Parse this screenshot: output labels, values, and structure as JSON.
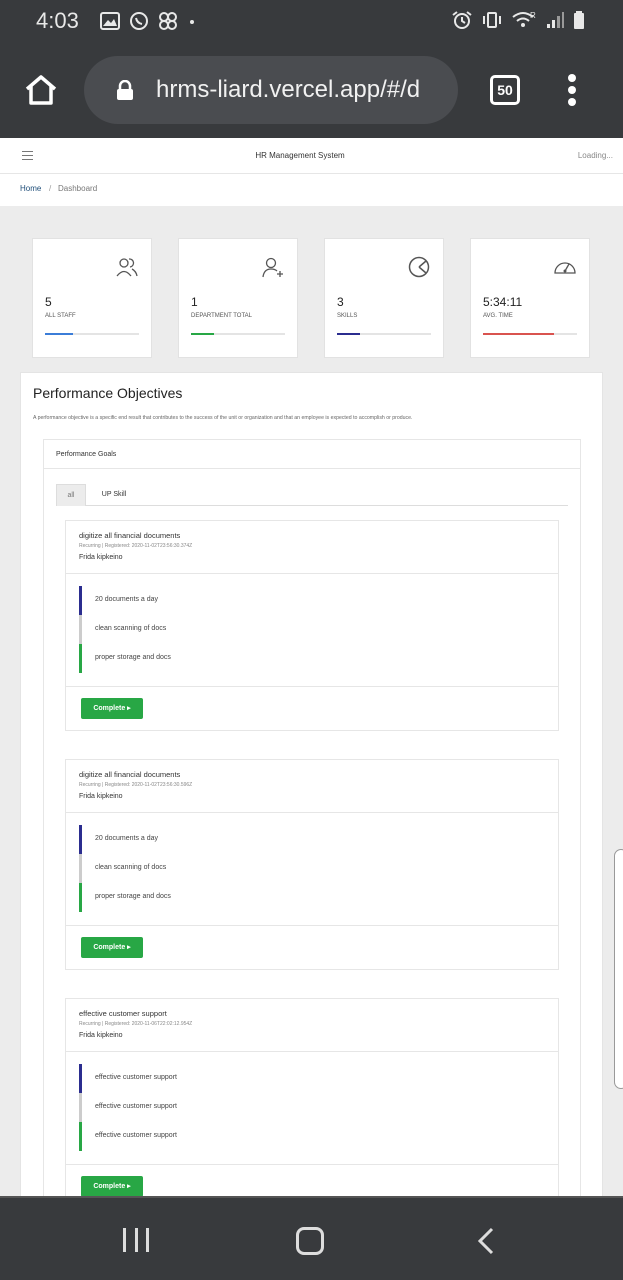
{
  "status": {
    "time": "4:03",
    "icons_left": [
      "gallery-icon",
      "whatsapp-icon",
      "pinwheel-icon",
      "dot-icon"
    ],
    "icons_right": [
      "alarm-icon",
      "vibrate-icon",
      "wifi-icon",
      "signal-icon",
      "battery-icon"
    ],
    "wifi_badge": "R"
  },
  "browser": {
    "url": "hrms-liard.vercel.app/#/d",
    "tab_count": "50"
  },
  "app": {
    "title": "HR Management System",
    "loading": "Loading..."
  },
  "breadcrumb": {
    "home": "Home",
    "separator": "/",
    "current": "Dashboard"
  },
  "stats": [
    {
      "value": "5",
      "label": "ALL STAFF",
      "icon": "users-icon",
      "color": "#3b7dd8",
      "fill": 0.3
    },
    {
      "value": "1",
      "label": "DEPARTMENT TOTAL",
      "icon": "add-user-icon",
      "color": "#28a745",
      "fill": 0.24
    },
    {
      "value": "3",
      "label": "SKILLS",
      "icon": "pie-chart-icon",
      "color": "#2b2d8f",
      "fill": 0.24
    },
    {
      "value": "5:34:11",
      "label": "AVG. TIME",
      "icon": "speedometer-icon",
      "color": "#d9534f",
      "fill": 0.75
    }
  ],
  "performance": {
    "title": "Performance Objectives",
    "description": "A performance objective is a specific end result that contributes to the success of the unit or organization and that an employee is expected to accomplish or produce.",
    "goals_header": "Performance Goals",
    "tabs": [
      "all",
      "UP Skill"
    ],
    "objectives": [
      {
        "name": "digitize all financial documents",
        "meta": "Recurring | Registered: 2020-11-02T23:56:30.374Z",
        "owner": "Frida kipkeino",
        "items": [
          {
            "text": "20 documents a day",
            "color": "#2b2d8f"
          },
          {
            "text": "clean scanning of docs",
            "color": "#cccccc"
          },
          {
            "text": "proper storage and docs",
            "color": "#28a745"
          }
        ],
        "button": "Complete ▸"
      },
      {
        "name": "digitize all financial documents",
        "meta": "Recurring | Registered: 2020-11-02T23:56:30.596Z",
        "owner": "Frida kipkeino",
        "items": [
          {
            "text": "20 documents a day",
            "color": "#2b2d8f"
          },
          {
            "text": "clean scanning of docs",
            "color": "#cccccc"
          },
          {
            "text": "proper storage and docs",
            "color": "#28a745"
          }
        ],
        "button": "Complete ▸"
      },
      {
        "name": "effective customer support",
        "meta": "Recurring | Registered: 2020-11-06T22:02:12.954Z",
        "owner": "Frida kipkeino",
        "items": [
          {
            "text": "effective customer support",
            "color": "#2b2d8f"
          },
          {
            "text": "effective customer support",
            "color": "#cccccc"
          },
          {
            "text": "effective customer support",
            "color": "#28a745"
          }
        ],
        "button": "Complete ▸"
      }
    ]
  }
}
